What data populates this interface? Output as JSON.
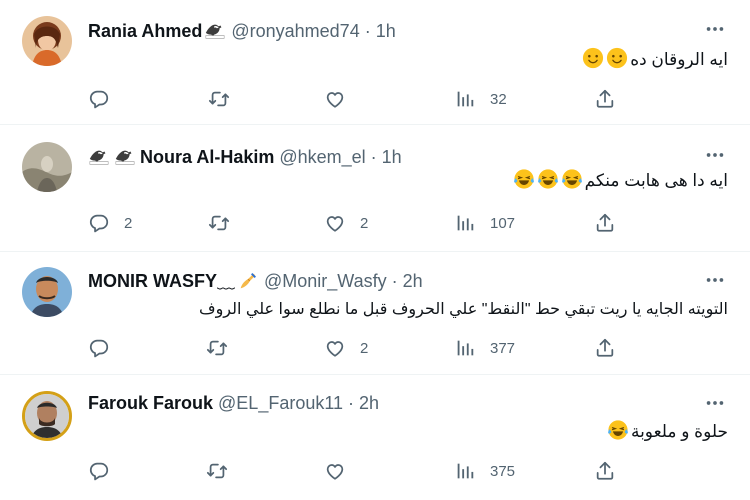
{
  "tweets": [
    {
      "name": "Rania Ahmed",
      "name_suffix_icon": "eagle-icon",
      "handle": "@ronyahmed74",
      "separator": "·",
      "time": "1h",
      "text": "ايه الروقان ده",
      "trailing_emojis": [
        "slightly-smiling-face-icon",
        "slightly-smiling-face-icon"
      ],
      "replies": "",
      "retweets": "",
      "likes": "",
      "views": "32"
    },
    {
      "name": "Noura Al-Hakim",
      "name_prefix_icons": [
        "eagle-icon",
        "eagle-icon"
      ],
      "handle": "@hkem_el",
      "separator": "·",
      "time": "1h",
      "text": "ايه دا  هى هابت منكم",
      "trailing_emojis": [
        "tears-of-joy-icon",
        "tears-of-joy-icon",
        "tears-of-joy-icon"
      ],
      "replies": "2",
      "retweets": "",
      "likes": "2",
      "views": "107"
    },
    {
      "name": "MONIR WASFY",
      "name_suffix_text": "﹏",
      "name_suffix_icon": "writing-hand-icon",
      "handle": "@Monir_Wasfy",
      "separator": "·",
      "time": "2h",
      "text": "التويته الجايه يا ريت تبقي حط \"النقط\" علي الحروف قبل ما نطلع سوا علي الروف",
      "replies": "",
      "retweets": "",
      "likes": "2",
      "views": "377"
    },
    {
      "name": "Farouk Farouk",
      "handle": "@EL_Farouk11",
      "separator": "·",
      "time": "2h",
      "text": "حلوة و ملعوبة",
      "trailing_emojis": [
        "tears-of-joy-icon"
      ],
      "replies": "",
      "retweets": "",
      "likes": "",
      "views": "375"
    }
  ],
  "colors": {
    "text": "#0f1419",
    "secondary": "#536471",
    "divider": "#eff3f4"
  }
}
